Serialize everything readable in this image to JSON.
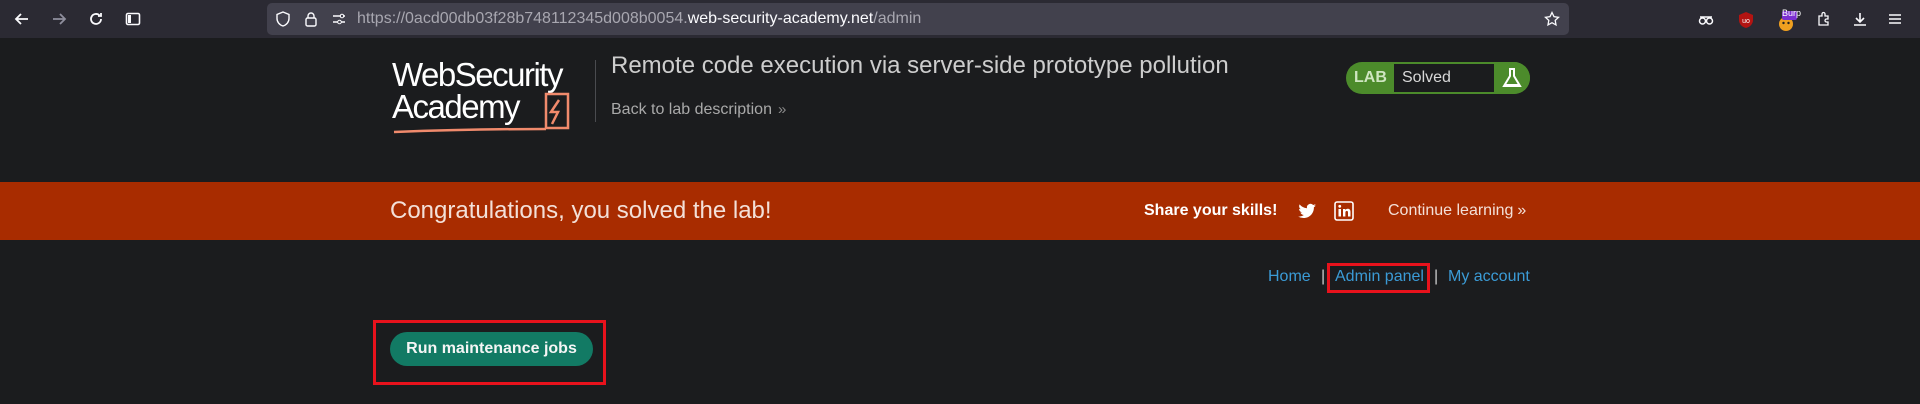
{
  "browser": {
    "url_prefix": "https://0acd00db03f28b748112345d008b0054.",
    "url_host": "web-security-academy.net",
    "url_path": "/admin",
    "extension_badge": "Burp"
  },
  "header": {
    "logo_line1": "WebSecurity",
    "logo_line2": "Academy",
    "lab_title": "Remote code execution via server-side prototype pollution",
    "back_link": "Back to lab description",
    "status_label": "LAB",
    "status_value": "Solved"
  },
  "banner": {
    "message": "Congratulations, you solved the lab!",
    "share_label": "Share your skills!",
    "continue_label": "Continue learning"
  },
  "nav": {
    "home": "Home",
    "admin": "Admin panel",
    "account": "My account",
    "separator": "|"
  },
  "main": {
    "run_button": "Run maintenance jobs"
  },
  "colors": {
    "banner": "#a82c00",
    "accent_green": "#4c8b2b",
    "button": "#127a64",
    "link": "#3b9bd6",
    "highlight": "#e8121c"
  }
}
